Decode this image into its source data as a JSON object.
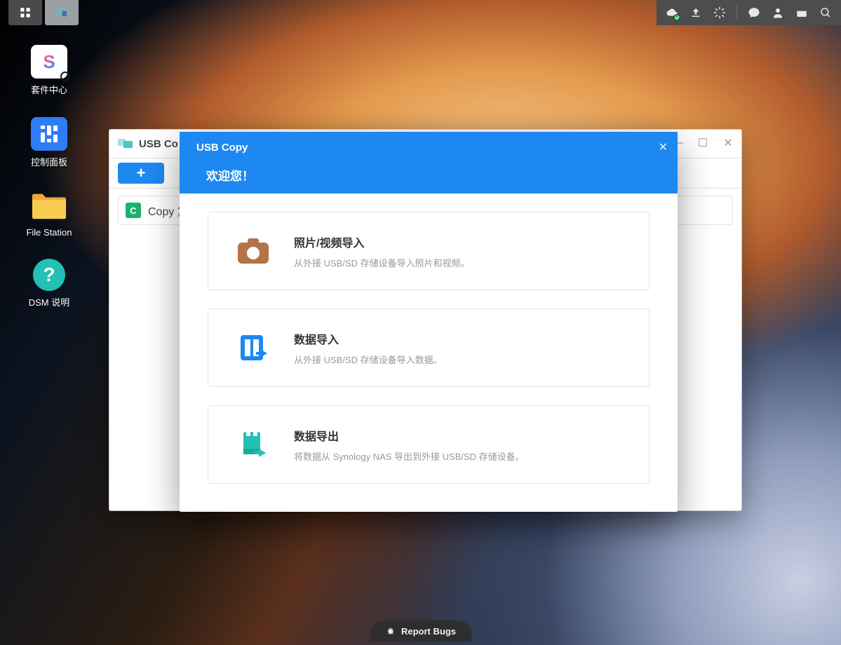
{
  "desktop": {
    "icons": [
      {
        "label": "套件中心"
      },
      {
        "label": "控制面板"
      },
      {
        "label": "File Station"
      },
      {
        "label": "DSM 说明"
      }
    ]
  },
  "window": {
    "title": "USB Co",
    "list_item": "Copy 复"
  },
  "modal": {
    "title": "USB Copy",
    "welcome": "欢迎您！",
    "cards": [
      {
        "title": "照片/视频导入",
        "desc": "从外接 USB/SD 存储设备导入照片和视频。"
      },
      {
        "title": "数据导入",
        "desc": "从外接 USB/SD 存储设备导入数据。"
      },
      {
        "title": "数据导出",
        "desc": "将数据从 Synology NAS 导出到外接 USB/SD 存储设备。"
      }
    ]
  },
  "footer": {
    "report": "Report Bugs"
  },
  "help_glyph": "?"
}
